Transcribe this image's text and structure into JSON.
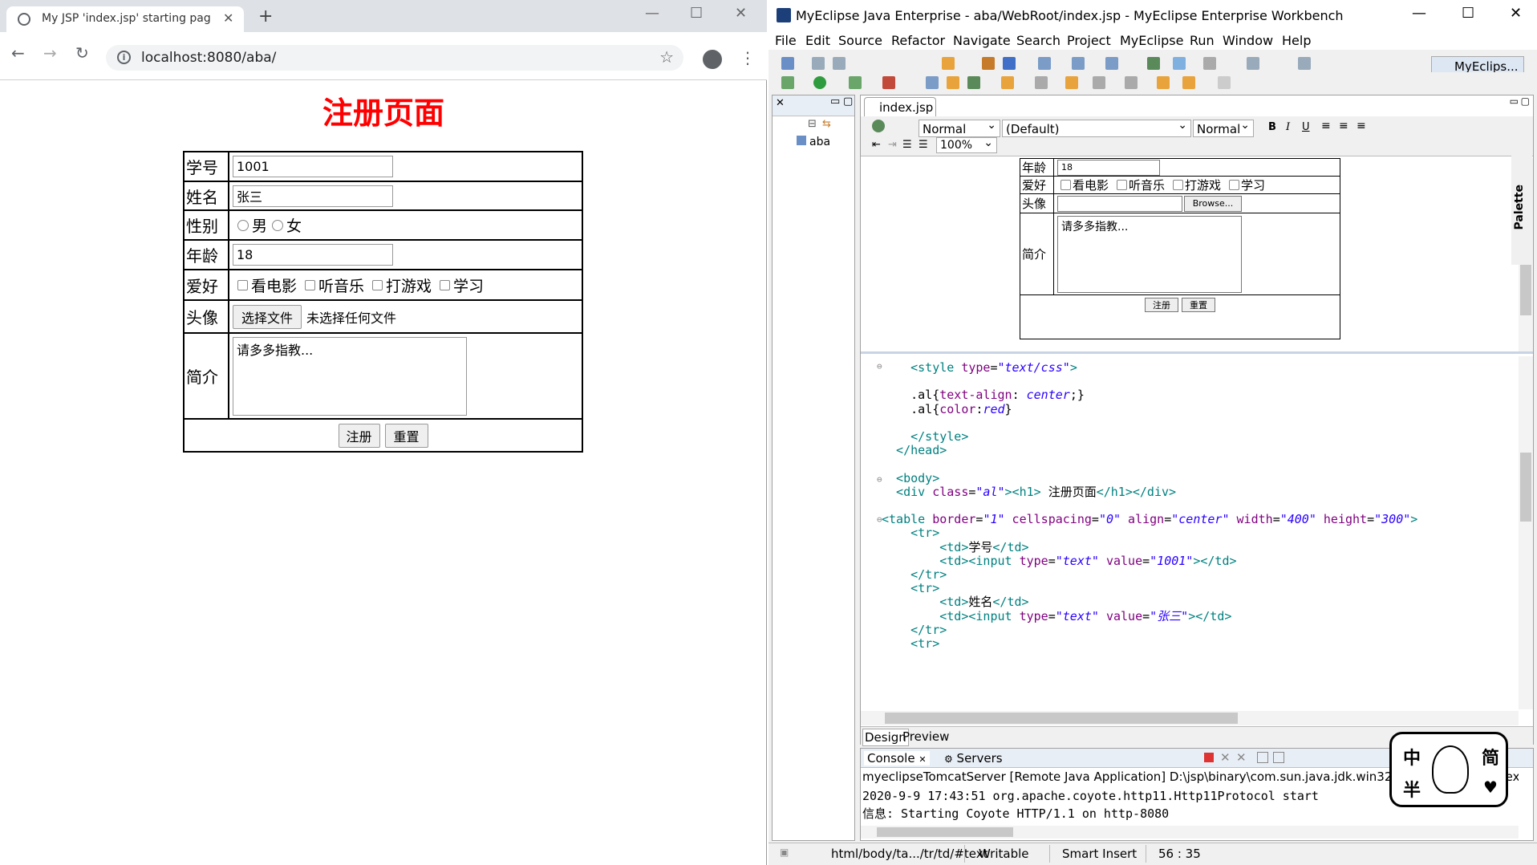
{
  "browser": {
    "tab_title": "My JSP 'index.jsp' starting pag",
    "url": "localhost:8080/aba/",
    "page": {
      "heading": "注册页面",
      "rows": {
        "id_label": "学号",
        "id_value": "1001",
        "name_label": "姓名",
        "name_value": "张三",
        "gender_label": "性别",
        "male": "男",
        "female": "女",
        "age_label": "年龄",
        "age_value": "18",
        "hobby_label": "爱好",
        "hobby1": "看电影",
        "hobby2": "听音乐",
        "hobby3": "打游戏",
        "hobby4": "学习",
        "avatar_label": "头像",
        "choose_file": "选择文件",
        "no_file": "未选择任何文件",
        "intro_label": "简介",
        "intro_value": "请多多指教...",
        "submit": "注册",
        "reset": "重置"
      }
    }
  },
  "ide": {
    "title": "MyEclipse Java Enterprise - aba/WebRoot/index.jsp - MyEclipse Enterprise Workbench",
    "menu": [
      "File",
      "Edit",
      "Source",
      "Refactor",
      "Navigate",
      "Search",
      "Project",
      "MyEclipse",
      "Run",
      "Window",
      "Help"
    ],
    "perspective": "MyEclips...",
    "project": "aba",
    "editor_tab": "index.jsp",
    "format_combo": "Normal",
    "font_combo": "(Default)",
    "size_combo": "Normal",
    "zoom": "100%",
    "design": {
      "age_label": "年龄",
      "age_value": "18",
      "hobby_label": "爱好",
      "hobby1": "看电影",
      "hobby2": "听音乐",
      "hobby3": "打游戏",
      "hobby4": "学习",
      "avatar_label": "头像",
      "browse": "Browse...",
      "intro_label": "简介",
      "intro_value": "请多多指教...",
      "submit": "注册",
      "reset": "重置"
    },
    "code_lines": [
      {
        "parts": [
          [
            "tg",
            "    <style "
          ],
          [
            "at",
            "type"
          ],
          [
            "tx",
            "="
          ],
          [
            "sv",
            "\"text/css\""
          ],
          [
            "tg",
            ">"
          ]
        ]
      },
      {
        "parts": []
      },
      {
        "parts": [
          [
            "tx",
            "    .al{"
          ],
          [
            "cs",
            "text-align"
          ],
          [
            "tx",
            ": "
          ],
          [
            "cv",
            "center"
          ],
          [
            "tx",
            ";}"
          ]
        ]
      },
      {
        "parts": [
          [
            "tx",
            "    .al{"
          ],
          [
            "cs",
            "color"
          ],
          [
            "tx",
            ":"
          ],
          [
            "cv",
            "red"
          ],
          [
            "tx",
            "}"
          ]
        ]
      },
      {
        "parts": []
      },
      {
        "parts": [
          [
            "tg",
            "    </style>"
          ]
        ]
      },
      {
        "parts": [
          [
            "tg",
            "  </head>"
          ]
        ]
      },
      {
        "parts": []
      },
      {
        "parts": [
          [
            "tg",
            "  <body>"
          ]
        ]
      },
      {
        "parts": [
          [
            "tg",
            "  <div "
          ],
          [
            "at",
            "class"
          ],
          [
            "tx",
            "="
          ],
          [
            "sv",
            "\"al\""
          ],
          [
            "tg",
            "><h1>"
          ],
          [
            "tx",
            " 注册页面"
          ],
          [
            "tg",
            "</h1></div>"
          ]
        ]
      },
      {
        "parts": []
      },
      {
        "parts": [
          [
            "tg",
            "<table "
          ],
          [
            "at",
            "border"
          ],
          [
            "tx",
            "="
          ],
          [
            "sv",
            "\"1\""
          ],
          [
            "at",
            " cellspacing"
          ],
          [
            "tx",
            "="
          ],
          [
            "sv",
            "\"0\""
          ],
          [
            "at",
            " align"
          ],
          [
            "tx",
            "="
          ],
          [
            "sv",
            "\"center\""
          ],
          [
            "at",
            " width"
          ],
          [
            "tx",
            "="
          ],
          [
            "sv",
            "\"400\""
          ],
          [
            "at",
            " height"
          ],
          [
            "tx",
            "="
          ],
          [
            "sv",
            "\"300\""
          ],
          [
            "tg",
            ">"
          ]
        ]
      },
      {
        "parts": [
          [
            "tg",
            "    <tr>"
          ]
        ]
      },
      {
        "parts": [
          [
            "tg",
            "        <td>"
          ],
          [
            "tx",
            "学号"
          ],
          [
            "tg",
            "</td>"
          ]
        ]
      },
      {
        "parts": [
          [
            "tg",
            "        <td><input "
          ],
          [
            "at",
            "type"
          ],
          [
            "tx",
            "="
          ],
          [
            "sv",
            "\"text\""
          ],
          [
            "at",
            " value"
          ],
          [
            "tx",
            "="
          ],
          [
            "sv",
            "\"1001\""
          ],
          [
            "tg",
            "></td>"
          ]
        ]
      },
      {
        "parts": [
          [
            "tg",
            "    </tr>"
          ]
        ]
      },
      {
        "parts": [
          [
            "tg",
            "    <tr>"
          ]
        ]
      },
      {
        "parts": [
          [
            "tg",
            "        <td>"
          ],
          [
            "tx",
            "姓名"
          ],
          [
            "tg",
            "</td>"
          ]
        ]
      },
      {
        "parts": [
          [
            "tg",
            "        <td><input "
          ],
          [
            "at",
            "type"
          ],
          [
            "tx",
            "="
          ],
          [
            "sv",
            "\"text\""
          ],
          [
            "at",
            " value"
          ],
          [
            "tx",
            "="
          ],
          [
            "sv",
            "\"张三\""
          ],
          [
            "tg",
            "></td>"
          ]
        ]
      },
      {
        "parts": [
          [
            "tg",
            "    </tr>"
          ]
        ]
      },
      {
        "parts": [
          [
            "tg",
            "    <tr>"
          ]
        ]
      }
    ],
    "design_tab": "Design",
    "preview_tab": "Preview",
    "console_tab": "Console",
    "servers_tab": "Servers",
    "console_header": "myeclipseTomcatServer [Remote Java Application] D:\\jsp\\binary\\com.sun.java.jdk.win32.x8",
    "console_header_tail": "w.ex",
    "console_lines": [
      "2020-9-9 17:43:51 org.apache.coyote.http11.Http11Protocol start",
      "信息: Starting Coyote HTTP/1.1 on http-8080"
    ],
    "status": {
      "path": "html/body/ta.../tr/td/#text",
      "mode": "Writable",
      "insert": "Smart Insert",
      "pos": "56 : 35"
    },
    "palette": "Palette",
    "sticker": {
      "c1": "中",
      "c2": "简",
      "c3": "半"
    }
  },
  "colors": {
    "heading_red": "#ff0000",
    "accent_blue": "#1c3f7a"
  }
}
